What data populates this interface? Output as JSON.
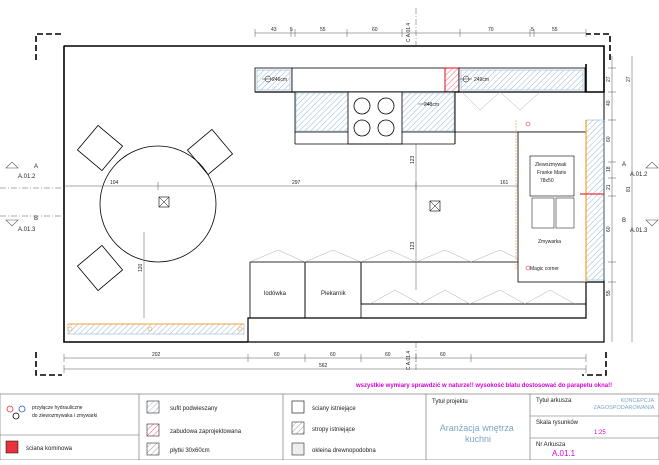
{
  "dimensions": {
    "top": [
      "43",
      "5",
      "55",
      "60",
      "70",
      "5",
      "55"
    ],
    "bottom_left": "202",
    "bottom_mid": [
      "60",
      "60",
      "60",
      "60"
    ],
    "bottom_total": "562",
    "right_upper": [
      "27",
      "27",
      "40",
      "60",
      "18"
    ],
    "right_lower": [
      "21",
      "81",
      "60",
      "55"
    ],
    "horizontal": [
      "104",
      "297",
      "161"
    ],
    "vertical": [
      "123",
      "123",
      "120"
    ]
  },
  "section_labels": {
    "top": "C\nA.01.4",
    "bottom": "C\nA.01.4",
    "a_left": "A\nA.01.2",
    "b_left": "B\nA.01.3",
    "a_right": "A\nA.01.2",
    "b_right": "B\nA.01.3"
  },
  "room_labels": {
    "pipe_1": "246cm",
    "pipe_2": "249cm",
    "cabinet_height": "248cm",
    "lodowka": "lodówka",
    "piekarnik": "Piekarnik",
    "zmywarka": "Zmywarka",
    "magic_corner": "Magic corner",
    "zlewozmywak_1": "Zlewozmywak",
    "zlewozmywak_2": "Franke Maris",
    "zlewozmywak_3": "78x50"
  },
  "warning": "wszystkie wymiary sprawdzić w naturze!! wysokość blatu dostosować do parapetu okna!!",
  "legend": [
    {
      "label": "przyłącze hydrauliczne do zlewozmywaka i zmywarki",
      "icon": "hydraulic-connection-icon"
    },
    {
      "label": "ściana kominowa",
      "icon": "chimney-wall-icon"
    },
    {
      "label": "sufit podwieszany",
      "icon": "suspended-ceiling-icon"
    },
    {
      "label": "zabudowa zaprojektowana",
      "icon": "designed-cabinetry-icon"
    },
    {
      "label": "płytki 30x60cm",
      "icon": "tiles-icon"
    },
    {
      "label": "ściany istniejące",
      "icon": "existing-walls-icon"
    },
    {
      "label": "stropy istniejące",
      "icon": "existing-ceilings-icon"
    },
    {
      "label": "okleina drewnopodobna",
      "icon": "wood-veneer-icon"
    }
  ],
  "titleblock": {
    "project_label": "Tytuł projektu",
    "project_title": "Aranżacja wnętrza kuchni",
    "sheet_label": "Tytuł arkusza",
    "sheet_title": "KONCEPCJA ZAGOSPODAROWANIA",
    "scale_label": "Skala rysunków",
    "scale": "1:25",
    "sheet_no_label": "Nr Arkusza",
    "sheet_no": "A.01.1"
  },
  "colors": {
    "accent_blue": "#7aa7c7",
    "magenta": "#d400d4",
    "chimney_red": "#e8323c",
    "window_orange": "#f0a030"
  }
}
